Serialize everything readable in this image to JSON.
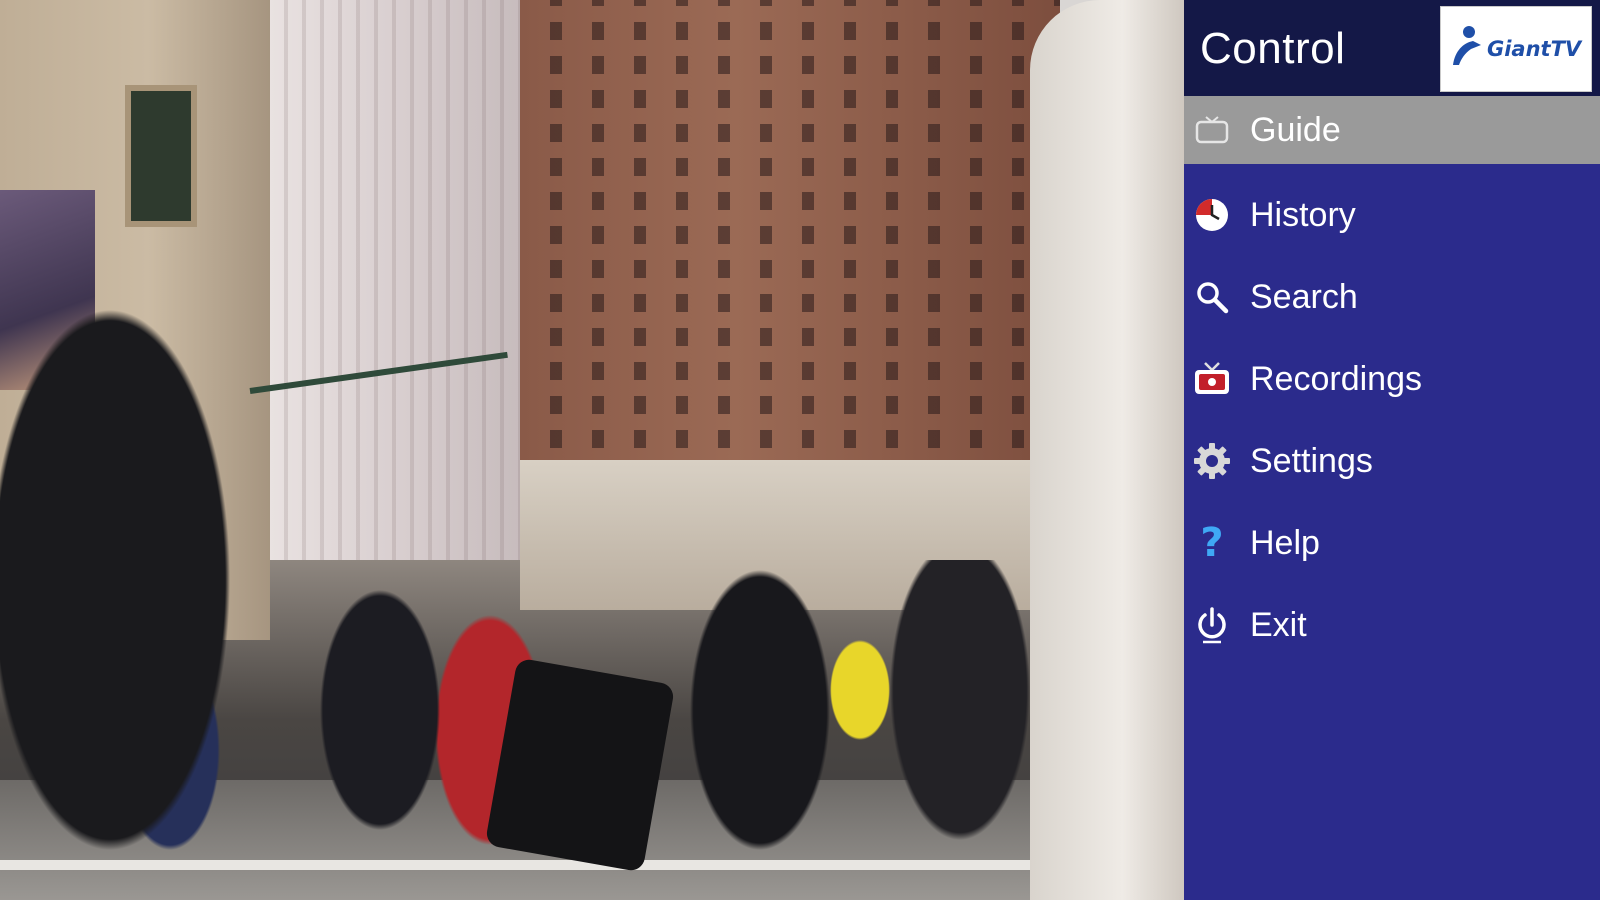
{
  "panel": {
    "title": "Control",
    "logo_text": "GiantTV",
    "colors": {
      "panel_bg": "#2b2b8c",
      "header_bg": "#141847",
      "active_item_bg": "#9a9a9a",
      "text": "#ffffff"
    },
    "items": [
      {
        "label": "Guide",
        "icon": "tv-icon",
        "active": true
      },
      {
        "label": "History",
        "icon": "clock-icon",
        "active": false
      },
      {
        "label": "Search",
        "icon": "search-icon",
        "active": false
      },
      {
        "label": "Recordings",
        "icon": "record-tv-icon",
        "active": false
      },
      {
        "label": "Settings",
        "icon": "gear-icon",
        "active": false
      },
      {
        "label": "Help",
        "icon": "question-icon",
        "active": false
      },
      {
        "label": "Exit",
        "icon": "power-icon",
        "active": false
      }
    ]
  }
}
